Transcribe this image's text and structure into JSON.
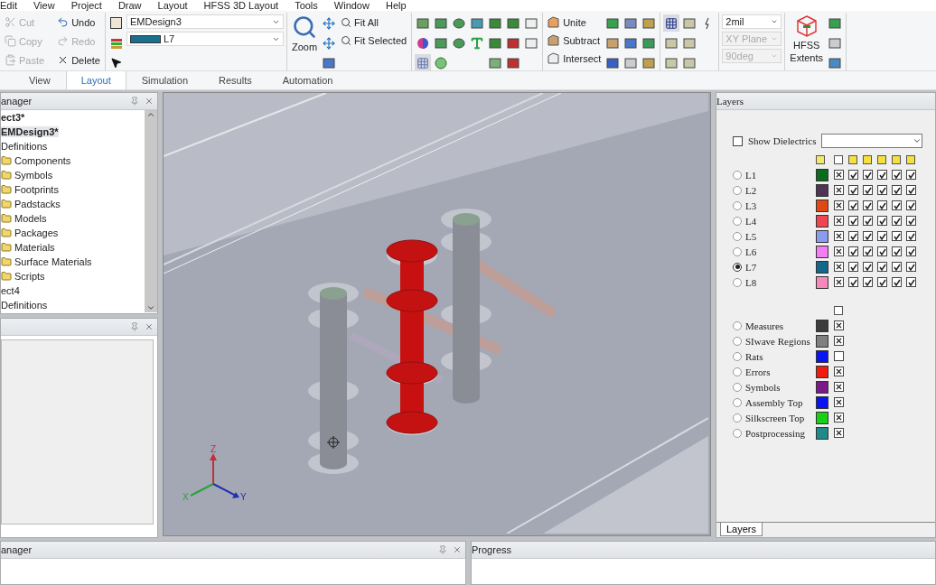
{
  "menu": [
    "Edit",
    "View",
    "Project",
    "Draw",
    "Layout",
    "HFSS 3D Layout",
    "Tools",
    "Window",
    "Help"
  ],
  "ribbon": {
    "clipboard": [
      {
        "label": "Cut",
        "kind": "cut",
        "disabled": true
      },
      {
        "label": "Undo",
        "kind": "undo",
        "disabled": false
      },
      {
        "label": "Copy",
        "kind": "copy",
        "disabled": true
      },
      {
        "label": "Redo",
        "kind": "redo",
        "disabled": true
      },
      {
        "label": "Paste",
        "kind": "paste",
        "disabled": true
      },
      {
        "label": "Delete",
        "kind": "delete",
        "disabled": false
      }
    ],
    "design_select": {
      "value": "EMDesign3"
    },
    "layer_select": {
      "value": "L7",
      "color": "#1a6f8c"
    },
    "zoom": {
      "label": "Zoom"
    },
    "fit": [
      {
        "label": "Fit All"
      },
      {
        "label": "Fit Selected"
      }
    ],
    "grid_toggle_on": true,
    "booleans": [
      {
        "label": "Unite",
        "kind": "unite"
      },
      {
        "label": "Subtract",
        "kind": "subtract"
      },
      {
        "label": "Intersect",
        "kind": "intersect"
      }
    ],
    "snap_toggle_on": true,
    "settings": [
      {
        "value": "2mil",
        "disabled": false
      },
      {
        "value": "XY Plane",
        "disabled": true
      },
      {
        "value": "90deg",
        "disabled": true
      }
    ],
    "extents": {
      "line1": "HFSS",
      "line2": "Extents"
    }
  },
  "tabs": [
    {
      "label": "View",
      "selected": false
    },
    {
      "label": "Layout",
      "selected": true
    },
    {
      "label": "Simulation",
      "selected": false
    },
    {
      "label": "Results",
      "selected": false
    },
    {
      "label": "Automation",
      "selected": false
    }
  ],
  "project_manager": {
    "title": "anager",
    "tree": [
      {
        "label": "ect3*",
        "bold": true,
        "selected": false,
        "folder": false,
        "children": [
          {
            "label": "EMDesign3*",
            "bold": true,
            "selected": true,
            "folder": false
          },
          {
            "label": "Definitions",
            "bold": false,
            "selected": false,
            "folder": false,
            "children": [
              {
                "label": "Components",
                "bold": false,
                "selected": false,
                "folder": true
              },
              {
                "label": "Symbols",
                "bold": false,
                "selected": false,
                "folder": true
              },
              {
                "label": "Footprints",
                "bold": false,
                "selected": false,
                "folder": true
              },
              {
                "label": "Padstacks",
                "bold": false,
                "selected": false,
                "folder": true
              },
              {
                "label": "Models",
                "bold": false,
                "selected": false,
                "folder": true
              },
              {
                "label": "Packages",
                "bold": false,
                "selected": false,
                "folder": true
              },
              {
                "label": "Materials",
                "bold": false,
                "selected": false,
                "folder": true
              },
              {
                "label": "Surface Materials",
                "bold": false,
                "selected": false,
                "folder": true
              },
              {
                "label": "Scripts",
                "bold": false,
                "selected": false,
                "folder": true
              }
            ]
          }
        ]
      },
      {
        "label": "ect4",
        "bold": false,
        "selected": false,
        "folder": false,
        "children": [
          {
            "label": "Definitions",
            "bold": false,
            "selected": false,
            "folder": false
          }
        ]
      }
    ]
  },
  "viewport": {
    "axes": {
      "z": "Z",
      "x": "X",
      "y": "Y"
    }
  },
  "layers_panel": {
    "title": "Layers",
    "show_dielectrics": {
      "label": "Show Dielectrics",
      "checked": false
    },
    "layers": [
      {
        "name": "L1",
        "selected": false,
        "color": "#0b6b1c",
        "checks": [
          true,
          true,
          true,
          true,
          true,
          true
        ]
      },
      {
        "name": "L2",
        "selected": false,
        "color": "#4d3553",
        "checks": [
          true,
          true,
          true,
          true,
          true,
          true
        ]
      },
      {
        "name": "L3",
        "selected": false,
        "color": "#e04a12",
        "checks": [
          true,
          true,
          true,
          true,
          true,
          true
        ]
      },
      {
        "name": "L4",
        "selected": false,
        "color": "#f04550",
        "checks": [
          true,
          true,
          true,
          true,
          true,
          true
        ]
      },
      {
        "name": "L5",
        "selected": false,
        "color": "#8a9cf0",
        "checks": [
          true,
          true,
          true,
          true,
          true,
          true
        ]
      },
      {
        "name": "L6",
        "selected": false,
        "color": "#f57cf2",
        "checks": [
          true,
          true,
          true,
          true,
          true,
          true
        ]
      },
      {
        "name": "L7",
        "selected": true,
        "color": "#13678a",
        "checks": [
          true,
          true,
          true,
          true,
          true,
          true
        ]
      },
      {
        "name": "L8",
        "selected": false,
        "color": "#f58aba",
        "checks": [
          true,
          true,
          true,
          true,
          true,
          true
        ]
      }
    ],
    "other_layers": [
      {
        "name": "Measures",
        "selected": false,
        "color": "#3c3c3c",
        "visible": true
      },
      {
        "name": "SIwave Regions",
        "selected": false,
        "color": "#7f7f7f",
        "visible": true
      },
      {
        "name": "Rats",
        "selected": false,
        "color": "#0a14f0",
        "visible": false
      },
      {
        "name": "Errors",
        "selected": false,
        "color": "#f01c10",
        "visible": true
      },
      {
        "name": "Symbols",
        "selected": false,
        "color": "#7a1a8a",
        "visible": true
      },
      {
        "name": "Assembly Top",
        "selected": false,
        "color": "#0a14f0",
        "visible": true
      },
      {
        "name": "Silkscreen Top",
        "selected": false,
        "color": "#18d018",
        "visible": true
      },
      {
        "name": "Postprocessing",
        "selected": false,
        "color": "#208a8a",
        "visible": true
      }
    ],
    "tab": "Layers"
  },
  "bottom": {
    "manager_title": "anager",
    "progress_title": "Progress"
  }
}
